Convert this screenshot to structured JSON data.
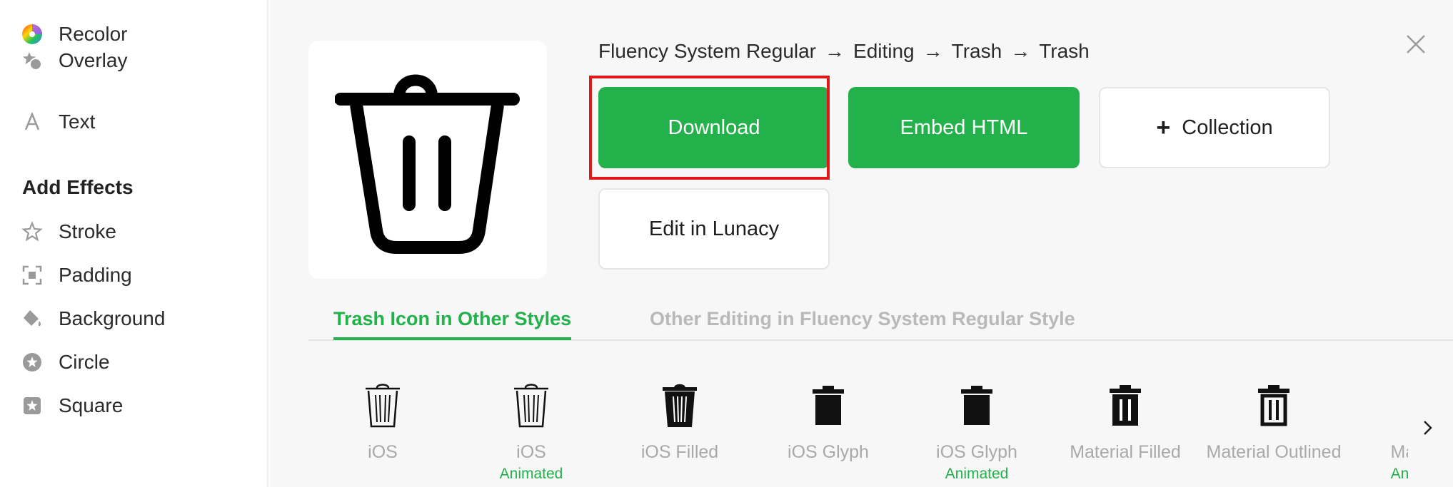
{
  "sidebar": {
    "items_top": [
      {
        "label": "Recolor",
        "icon": "color-wheel-icon"
      },
      {
        "label": "Overlay",
        "icon": "overlay-icon"
      },
      {
        "label": "Text",
        "icon": "text-icon"
      }
    ],
    "effects_heading": "Add Effects",
    "effects": [
      {
        "label": "Stroke",
        "icon": "star-outline-icon"
      },
      {
        "label": "Padding",
        "icon": "padding-icon"
      },
      {
        "label": "Background",
        "icon": "paint-bucket-icon"
      },
      {
        "label": "Circle",
        "icon": "circle-star-icon"
      },
      {
        "label": "Square",
        "icon": "square-star-icon"
      }
    ]
  },
  "breadcrumb": [
    "Fluency System Regular",
    "Editing",
    "Trash",
    "Trash"
  ],
  "breadcrumb_separator": "→",
  "buttons": {
    "download": "Download",
    "embed": "Embed HTML",
    "collection_plus": "+",
    "collection": "Collection",
    "lunacy": "Edit in Lunacy"
  },
  "tabs": [
    {
      "label": "Trash Icon in Other Styles",
      "active": true
    },
    {
      "label": "Other Editing in Fluency System Regular Style",
      "active": false
    }
  ],
  "styles": [
    {
      "name": "iOS",
      "sub": "",
      "icon": "trash-outline-icon"
    },
    {
      "name": "iOS",
      "sub": "Animated",
      "icon": "trash-outline-icon"
    },
    {
      "name": "iOS Filled",
      "sub": "",
      "icon": "trash-filled-icon"
    },
    {
      "name": "iOS Glyph",
      "sub": "",
      "icon": "trash-glyph-icon"
    },
    {
      "name": "iOS Glyph",
      "sub": "Animated",
      "icon": "trash-glyph-icon"
    },
    {
      "name": "Material Filled",
      "sub": "",
      "icon": "trash-material-filled-icon"
    },
    {
      "name": "Material Outlined",
      "sub": "",
      "icon": "trash-material-outlined-icon"
    },
    {
      "name": "Material",
      "sub": "Animated",
      "icon": "trash-partial-icon"
    }
  ],
  "colors": {
    "accent": "#22b14a",
    "highlight": "#e01818",
    "background": "#f7f7f7"
  }
}
